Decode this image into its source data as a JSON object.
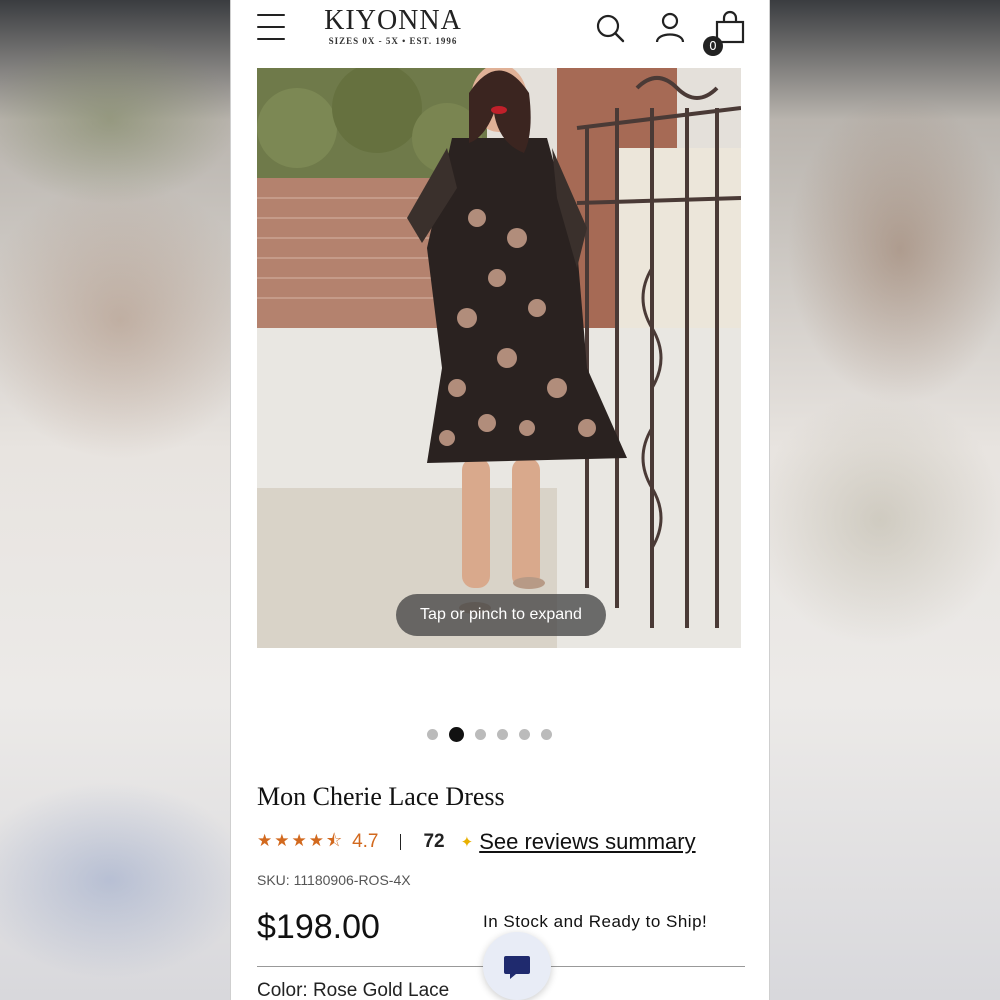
{
  "brand": {
    "logo_text": "KIYONNA",
    "tagline": "SIZES 0X - 5X • EST. 1996"
  },
  "header": {
    "cart_count": "0"
  },
  "gallery": {
    "expand_hint": "Tap or pinch to expand",
    "total_images": 6,
    "active_index": 1
  },
  "product": {
    "title": "Mon Cherie Lace Dress",
    "rating": "4.7",
    "stars_display": "★★★★⯪",
    "review_count": "72",
    "reviews_link": "See reviews summary",
    "sku": "SKU: 11180906-ROS-4X",
    "price": "$198.00",
    "stock_status": "In Stock and Ready to Ship!",
    "color_label": "Color: Rose Gold Lace"
  },
  "colors": {
    "rating_accent": "#d2691e",
    "sparkle": "#e8b000",
    "text": "#111111"
  },
  "icons": {
    "menu": "hamburger-icon",
    "search": "search-icon",
    "account": "user-icon",
    "cart": "bag-icon",
    "chat": "chat-icon"
  }
}
